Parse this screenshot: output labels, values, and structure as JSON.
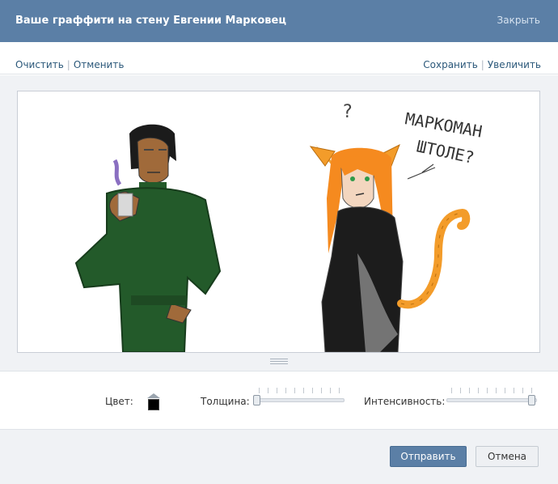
{
  "header": {
    "title": "Ваше граффити на стену Евгении Марковец",
    "close_label": "Закрыть"
  },
  "toolbar": {
    "clear_label": "Очистить",
    "undo_label": "Отменить",
    "save_label": "Сохранить",
    "enlarge_label": "Увеличить",
    "separator": "|"
  },
  "canvas": {
    "drawing_text_line1": "МАРКОМАН",
    "drawing_text_line2": "ШТОЛЕ?",
    "drawing_question_mark": "?"
  },
  "controls": {
    "color_label": "Цвет:",
    "color_value": "#000000",
    "thickness_label": "Толщина:",
    "thickness_value": 0,
    "intensity_label": "Интенсивность:",
    "intensity_value": 1
  },
  "footer": {
    "send_label": "Отправить",
    "cancel_label": "Отмена"
  },
  "colors": {
    "header_bg": "#5b7fa6",
    "link": "#2b587a",
    "send_button": "#5b7fa6"
  }
}
